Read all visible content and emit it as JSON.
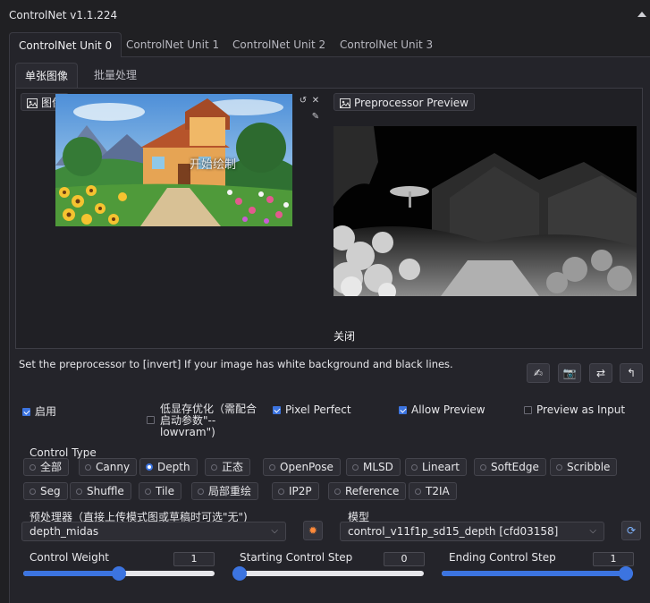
{
  "header": {
    "title": "ControlNet v1.1.224"
  },
  "unit_tabs": [
    "ControlNet Unit 0",
    "ControlNet Unit 1",
    "ControlNet Unit 2",
    "ControlNet Unit 3"
  ],
  "sub_tabs": [
    "单张图像",
    "批量处理"
  ],
  "image_panel": {
    "label": "图像",
    "overlay_text": "开始绘制",
    "preview_label": "Preprocessor Preview",
    "close_label": "关闭"
  },
  "hint": "Set the preprocessor to [invert] If your image has white background and black lines.",
  "tool_buttons": [
    "✍",
    "📷",
    "⇄",
    "↰"
  ],
  "checks": {
    "enable": {
      "label": "启用",
      "checked": true
    },
    "low_vram": {
      "label": "低显存优化（需配合启动参数\"--lowvram\")",
      "checked": false
    },
    "pixel_perfect": {
      "label": "Pixel Perfect",
      "checked": true
    },
    "allow_preview": {
      "label": "Allow Preview",
      "checked": true
    },
    "preview_input": {
      "label": "Preview as Input",
      "checked": false
    }
  },
  "control_type": {
    "title": "Control Type",
    "options": [
      "全部",
      "Canny",
      "Depth",
      "正态",
      "OpenPose",
      "MLSD",
      "Lineart",
      "SoftEdge",
      "Scribble",
      "Seg",
      "Shuffle",
      "Tile",
      "局部重绘",
      "IP2P",
      "Reference",
      "T2IA"
    ],
    "selected": "Depth"
  },
  "preprocessor": {
    "label": "预处理器（直接上传模式图或草稿时可选\"无\")",
    "value": "depth_midas"
  },
  "model": {
    "label": "模型",
    "value": "control_v11f1p_sd15_depth [cfd03158]"
  },
  "sliders": {
    "weight": {
      "label": "Control Weight",
      "value": "1",
      "fraction": 0.5
    },
    "start": {
      "label": "Starting Control Step",
      "value": "0",
      "fraction": 0.0
    },
    "end": {
      "label": "Ending Control Step",
      "value": "1",
      "fraction": 1.0
    }
  }
}
